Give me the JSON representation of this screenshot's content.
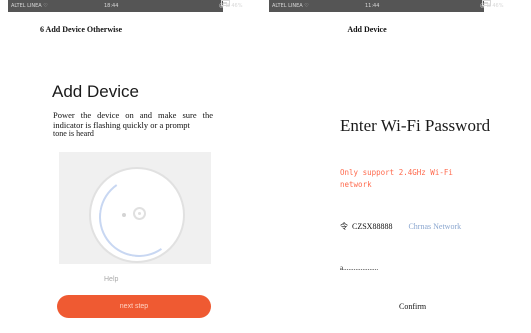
{
  "left_screen": {
    "status_bar": {
      "left": "ALTEL LINEA ♡",
      "time": "18:44",
      "right": "@ ⊠ 46% "
    },
    "topbar_title": "6 Add Device Otherwise",
    "heading": "Add Device",
    "instructions": "Power the device on and make sure the indicator is flashing quickly or a prompt",
    "overlap_text": "tone is heard",
    "help_label": "Help",
    "next_button_label": "next step"
  },
  "right_screen": {
    "status_bar": {
      "left": "ALTEL LINEA ♡",
      "time": "11:44",
      "right": "@ ⊠ 46% "
    },
    "topbar_title": "Add Device",
    "heading": "Enter Wi-Fi Password",
    "wifi_note": "Only support 2.4GHz Wi-Fi network",
    "wifi_icon_glyph": "令",
    "ssid": "CZSX88888",
    "change_network_label": "Chrnas Network",
    "password_value": "a....................",
    "confirm_label": "Confirm"
  },
  "colors": {
    "accent": "#ef5a32",
    "note": "#ff6a4d",
    "link": "#8aa6cf",
    "illustration_bg": "#f0f0f0"
  }
}
